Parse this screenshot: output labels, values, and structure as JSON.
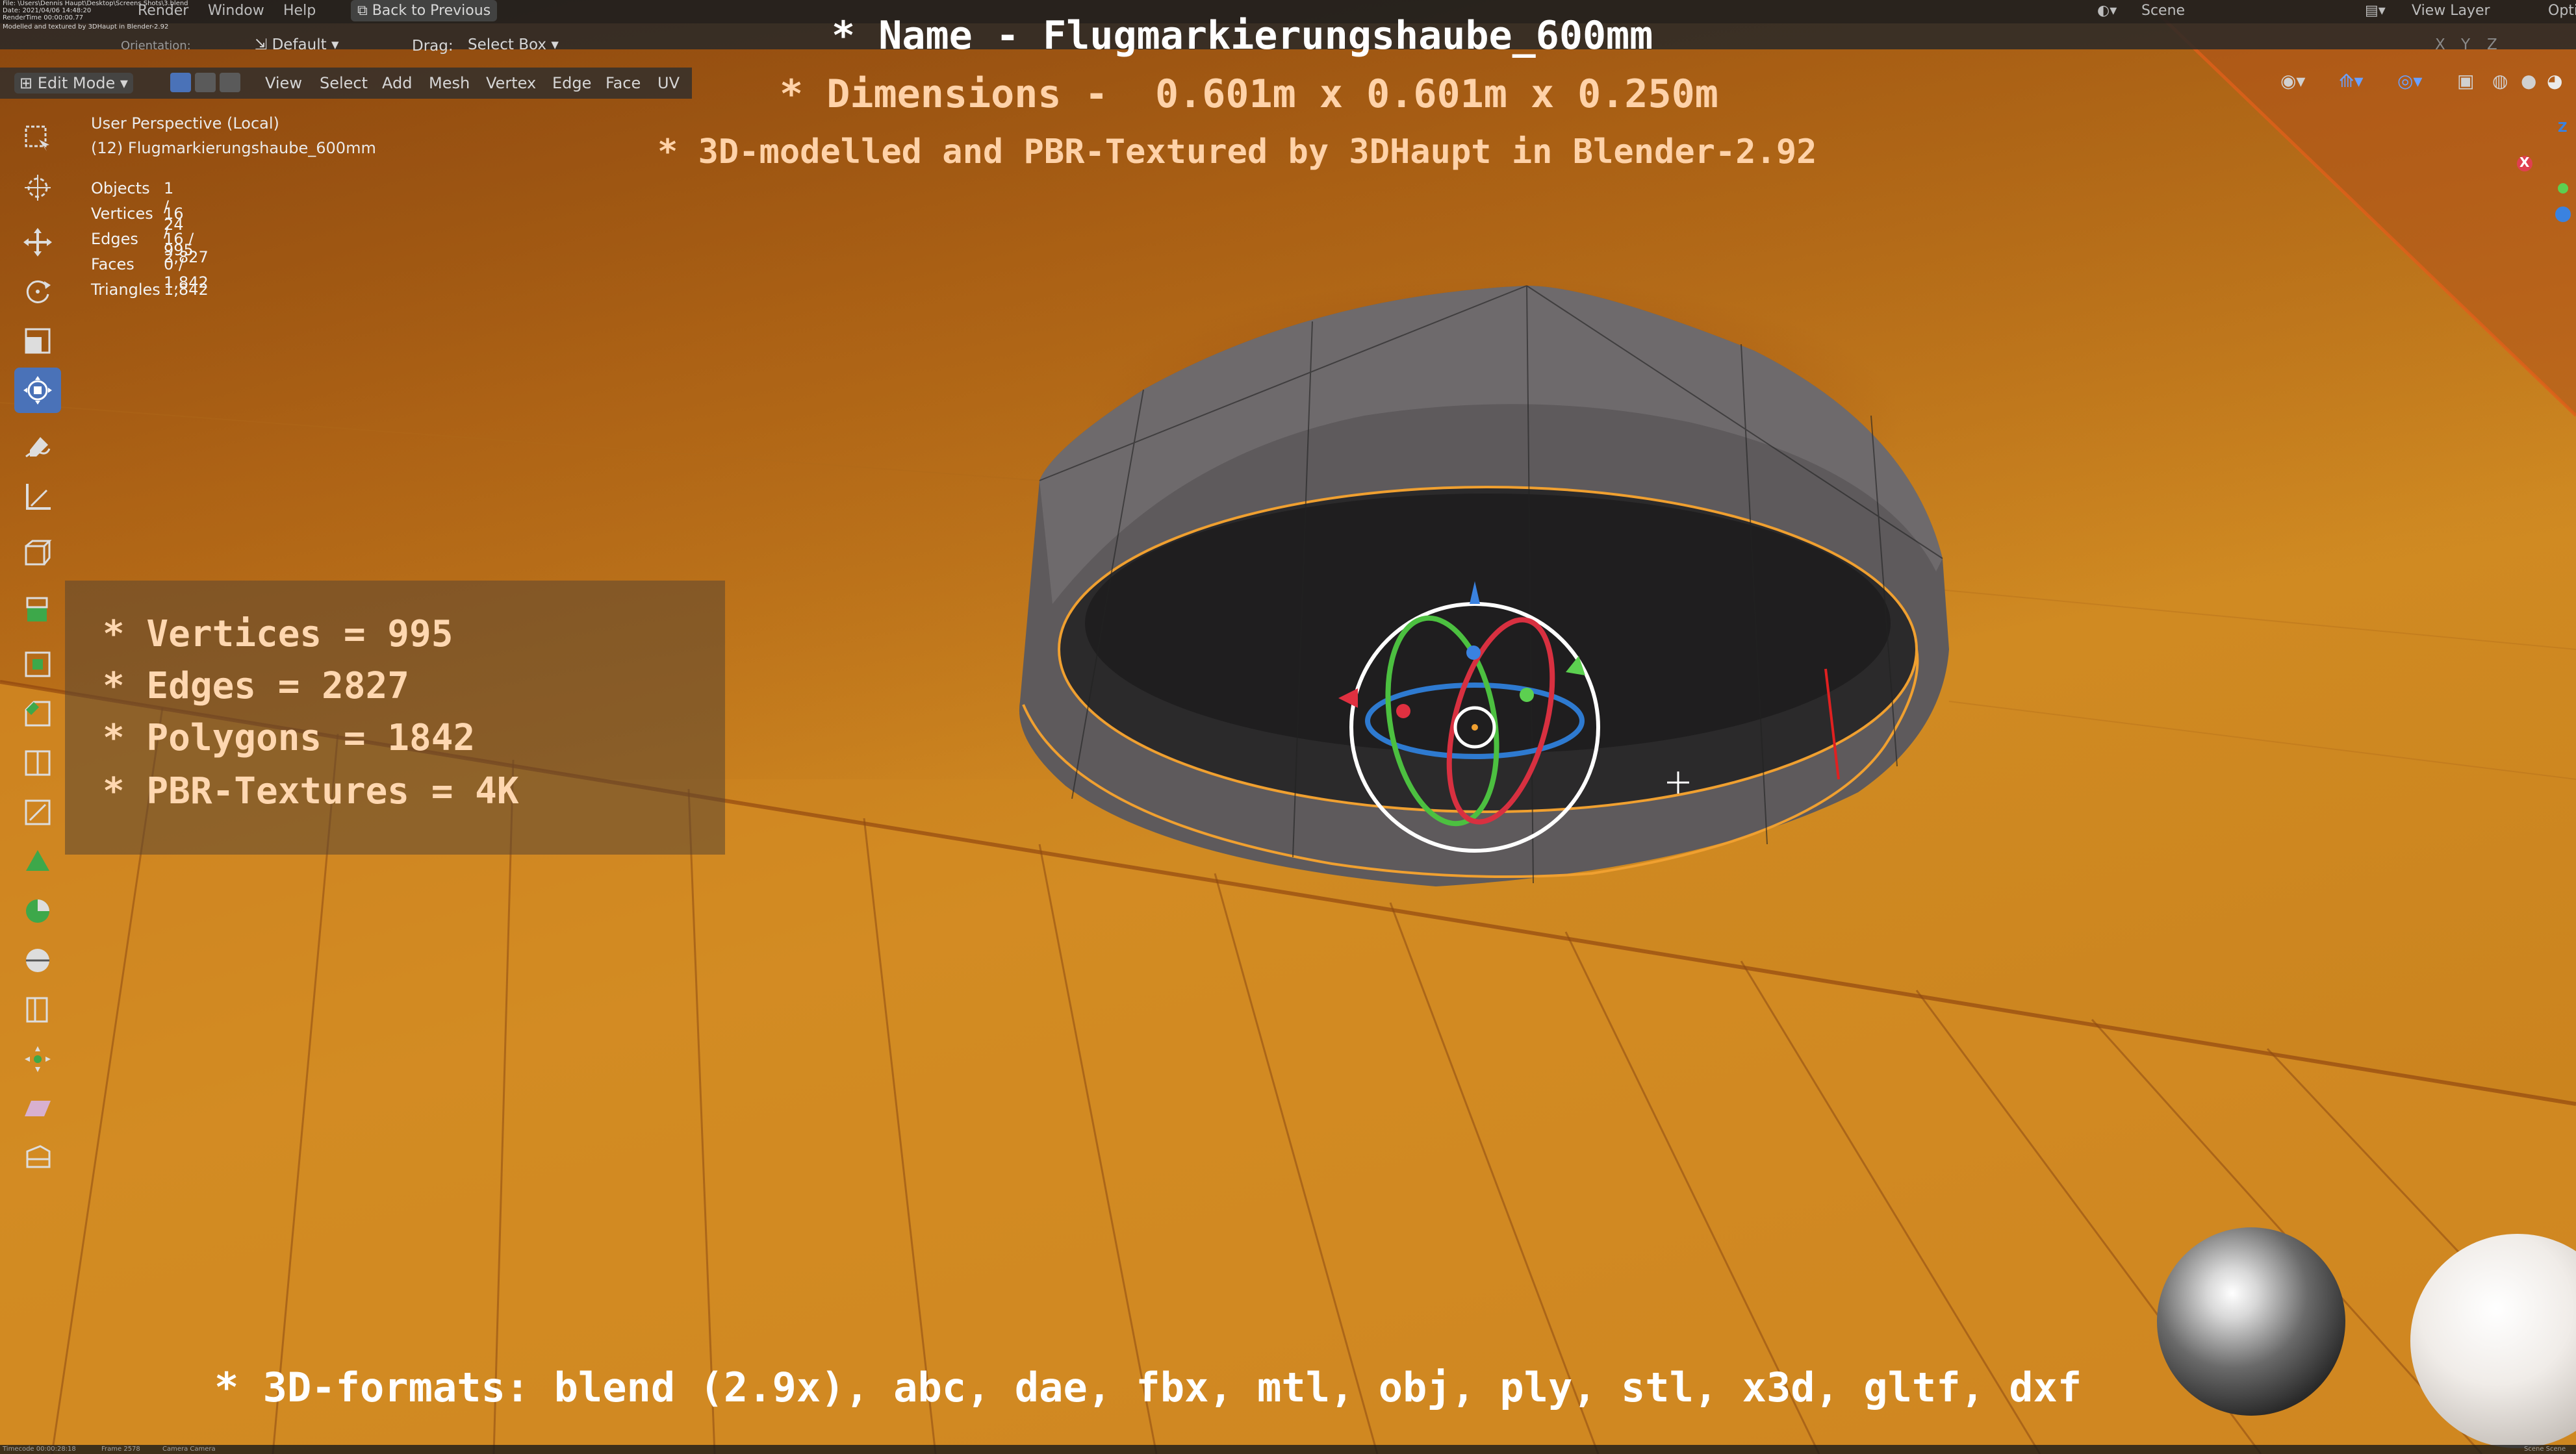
{
  "topbar": {
    "path_lines": [
      "File: \\Users\\Dennis Haupt\\Desktop\\Screens Shots\\3.blend",
      "Date: 2021/04/06 14:48:20",
      "RenderTime 00:00:00.77",
      "Modelled and textured by 3DHaupt in Blender-2.92"
    ],
    "menu_render": "Render",
    "menu_window": "Window",
    "menu_help": "Help",
    "back_button": "Back to Previous",
    "scene_label": "Scene",
    "view_layer_label": "View Layer",
    "options_label": "Opti"
  },
  "header2": {
    "orientation_label": "Orientation:",
    "orientation_value": "Default",
    "drag_label": "Drag:",
    "drag_value": "Select Box",
    "axis_x": "X",
    "axis_y": "Y",
    "axis_z": "Z"
  },
  "header3": {
    "mode": "Edit Mode",
    "menus": [
      "View",
      "Select",
      "Add",
      "Mesh",
      "Vertex",
      "Edge",
      "Face",
      "UV"
    ]
  },
  "viewport": {
    "perspective": "User Perspective (Local)",
    "object_name": "(12) Flugmarkierungshaube_600mm"
  },
  "stats": [
    {
      "label": "Objects",
      "value": "1 / 24"
    },
    {
      "label": "Vertices",
      "value": "16 / 995"
    },
    {
      "label": "Edges",
      "value": "16 / 2,827"
    },
    {
      "label": "Faces",
      "value": "0 / 1,842"
    },
    {
      "label": "Triangles",
      "value": "1,842"
    }
  ],
  "overlay": {
    "name_line": "* Name - Flugmarkierungshaube_600mm",
    "dimensions_line": "* Dimensions -  0.601m x 0.601m x 0.250m",
    "credit_line": "* 3D-modelled and PBR-Textured by 3DHaupt in Blender-2.92",
    "panel_lines": [
      "* Vertices = 995",
      "* Edges = 2827",
      "* Polygons = 1842",
      "* PBR-Textures = 4K"
    ],
    "formats_line": "* 3D-formats: blend (2.9x), abc, dae, fbx, mtl, obj, ply, stl, x3d, gltf, dxf"
  },
  "statusbar": {
    "timecode": "Timecode 00:00:28:18",
    "frame": "Frame 2578",
    "camera": "Camera Camera",
    "scene_right": "Scene Scene"
  },
  "nav_gizmo": {
    "x_label": "X",
    "z_label": "Z"
  },
  "colors": {
    "title_text": "#ffffff",
    "subtitle_text": "#ffd2a8",
    "panel_text": "#ffd7b0",
    "active_tool": "#4a72b8",
    "wood": "#c9801e",
    "selection_orange": "#f0a030"
  },
  "icons": {
    "toolbar": [
      "select-box-icon",
      "cursor-icon",
      "move-icon",
      "rotate-icon",
      "scale-icon",
      "transform-icon",
      "annotate-icon",
      "measure-icon",
      "add-cube-icon",
      "extrude-icon",
      "inset-icon",
      "bevel-icon",
      "loop-cut-icon",
      "knife-icon",
      "poly-build-icon",
      "spin-icon",
      "smooth-icon",
      "edge-slide-icon",
      "shrink-fatten-icon",
      "shear-icon",
      "rip-icon"
    ]
  }
}
